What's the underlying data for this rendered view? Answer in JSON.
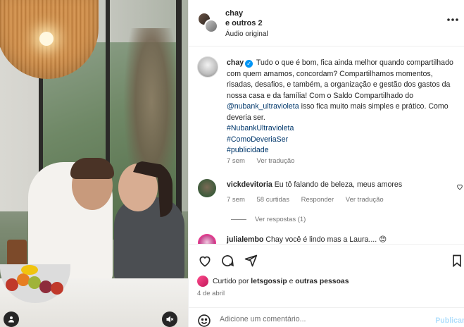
{
  "header": {
    "username": "chay",
    "coauthors": " e outros 2",
    "audio": "Áudio original",
    "more_icon": "more-horizontal-icon"
  },
  "caption": {
    "username": "chay",
    "text_1": "Tudo o que é bom, fica ainda melhor quando compartilhado com quem amamos, concordam? Compartilhamos momentos, risadas, desafios, e também, a organização e gestão dos gastos da nossa casa e da família! Com o Saldo Compartilhado do ",
    "mention": "@nubank_ultravioleta",
    "text_2": " isso fica muito mais simples e prático. Como deveria ser.",
    "hashtags": [
      "#NubankUltravioleta",
      "#ComoDeveriaSer",
      "#publicidade"
    ],
    "time": "7 sem",
    "translate": "Ver tradução"
  },
  "comments": [
    {
      "username": "vickdevitoria",
      "text": "Eu tô falando de beleza, meus amores",
      "time": "7 sem",
      "likes": "58 curtidas",
      "reply": "Responder",
      "translate": "Ver tradução",
      "replies": "Ver respostas (1)"
    },
    {
      "username": "julialembo",
      "text": "Chay você é lindo mas a Laura.... 😍"
    }
  ],
  "likes": {
    "prefix": "Curtido por ",
    "user": "letsgossip",
    "suffix": " e ",
    "others": "outras pessoas"
  },
  "date": "4 de abril",
  "comment_box": {
    "placeholder": "Adicione um comentário...",
    "publish": "Publicar"
  },
  "colors": {
    "link": "#00376b",
    "verified": "#0095f6",
    "publish_disabled": "#b2dffc"
  }
}
